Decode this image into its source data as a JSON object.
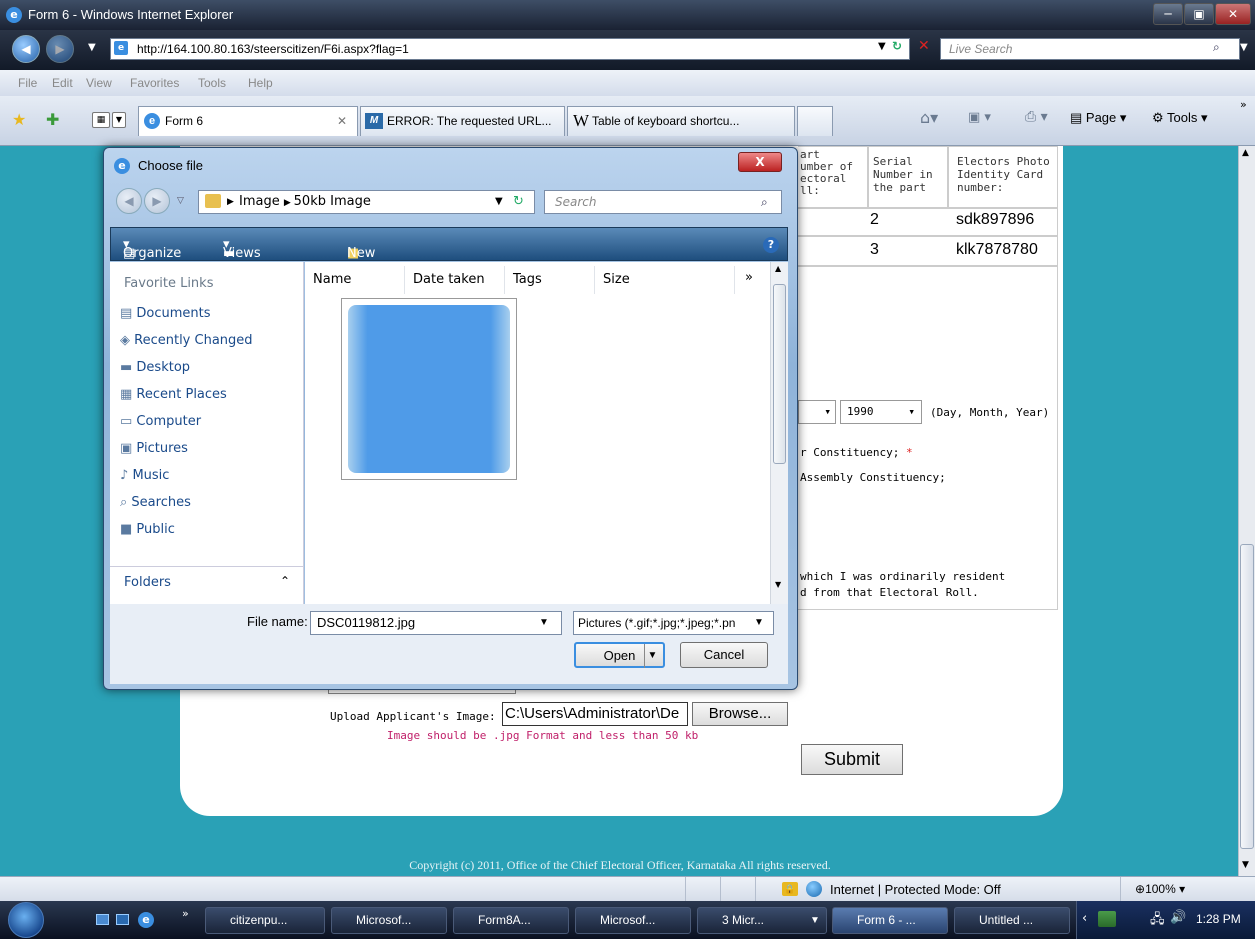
{
  "window": {
    "title": "Form 6 - Windows Internet Explorer",
    "minimize": "─",
    "maximize": "▣",
    "close": "✕"
  },
  "nav": {
    "url": "http://164.100.80.163/steerscitizen/F6i.aspx?flag=1",
    "search_placeholder": "Live Search"
  },
  "menu": [
    "File",
    "Edit",
    "View",
    "Favorites",
    "Tools",
    "Help"
  ],
  "tabs": [
    {
      "label": "Form 6"
    },
    {
      "label": "ERROR: The requested URL..."
    },
    {
      "label": "Table of keyboard shortcu..."
    }
  ],
  "toolbar": {
    "page": "Page",
    "tools": "Tools"
  },
  "form": {
    "table_headers": [
      "art\number of\nectoral\nll:",
      "Serial\nNumber in\nthe part",
      "Electors Photo\nIdentity Card\nnumber:"
    ],
    "rows": [
      {
        "serial": "2",
        "card": "sdk897896"
      },
      {
        "serial": "3",
        "card": "klk7878780"
      }
    ],
    "year": "1990",
    "date_hint": "(Day, Month, Year)",
    "constituency1": "r Constituency;",
    "required": "*",
    "constituency2": "Assembly Constituency;",
    "resident1": "which I was ordinarily resident",
    "resident2": "d from that Electoral Roll.",
    "upload_label": "Upload Applicant's Image:",
    "upload_path": "C:\\Users\\Administrator\\De",
    "browse": "Browse...",
    "upload_hint": "Image should be .jpg Format and less than 50 kb",
    "submit": "Submit",
    "copyright": "Copyright (c) 2011, Office of the Chief Electoral Officer, Karnataka All rights reserved."
  },
  "dialog": {
    "title": "Choose file",
    "close": "X",
    "breadcrumb": [
      "Image",
      "50kb Image"
    ],
    "search_placeholder": "Search",
    "organize": "Organize",
    "views": "Views",
    "new_folder": "New Folder",
    "favorites_header": "Favorite Links",
    "favorites": [
      "Documents",
      "Recently Changed",
      "Desktop",
      "Recent Places",
      "Computer",
      "Pictures",
      "Music",
      "Searches",
      "Public"
    ],
    "folders": "Folders",
    "columns": [
      "Name",
      "Date taken",
      "Tags",
      "Size"
    ],
    "more": "»",
    "file_name_label": "File name:",
    "file_name": "DSC0119812.jpg",
    "file_type": "Pictures (*.gif;*.jpg;*.jpeg;*.pn",
    "open": "Open",
    "cancel": "Cancel"
  },
  "status": {
    "zone": "Internet | Protected Mode: Off",
    "zoom": "100%"
  },
  "taskbar": {
    "items": [
      "citizenpu...",
      "Microsof...",
      "Form8A...",
      "Microsof...",
      "3 Micr...",
      "Form 6 - ...",
      "Untitled ..."
    ],
    "time": "1:28 PM"
  }
}
